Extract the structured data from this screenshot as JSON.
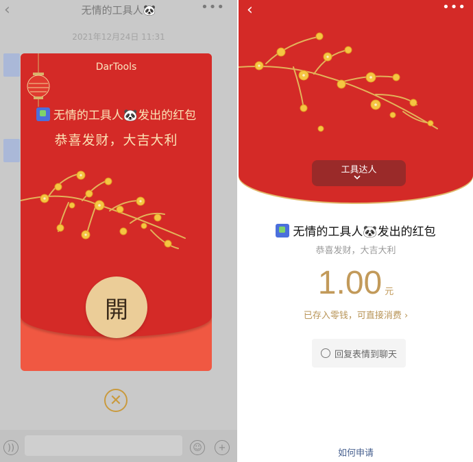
{
  "left_screen": {
    "chat_title": "无情的工具人🐼",
    "back_icon": "chevron-left-icon",
    "more_icon": "ellipsis-icon",
    "timestamp": "2021年12月24日 11:31",
    "red_packet": {
      "brand": "DarTools",
      "sender_line": "无情的工具人🐼发出的红包",
      "wish": "恭喜发财，大吉大利",
      "open_label": "開",
      "close_icon": "close-circle-icon"
    },
    "input_bar": {
      "voice_icon": "voice-icon",
      "emoji_icon": "emoji-icon",
      "plus_icon": "plus-icon"
    }
  },
  "right_screen": {
    "back_icon": "chevron-left-icon",
    "more_icon": "ellipsis-icon",
    "cover_tag": "工具达人",
    "sender_line": "无情的工具人🐼发出的红包",
    "wish": "恭喜发财，大吉大利",
    "amount": "1.00",
    "unit": "元",
    "stored_text": "已存入零钱，可直接消费 ›",
    "reply_button": "回复表情到聊天",
    "how_to_apply": "如何申请"
  },
  "colors": {
    "packet_red": "#d42a27",
    "packet_gold": "#ebcd98",
    "amount_gold": "#c29a5a",
    "link_blue": "#465f8e"
  }
}
